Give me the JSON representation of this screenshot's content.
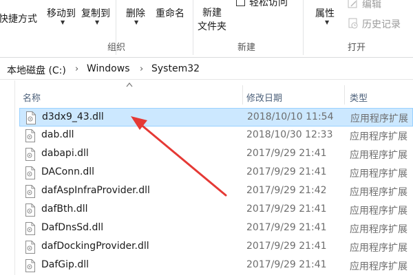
{
  "ribbon": {
    "clipboard": {
      "paste_shortcut_label": "快捷方式",
      "move_to_label": "移动到",
      "copy_to_label": "复制到"
    },
    "organize": {
      "delete_label": "删除",
      "rename_label": "重命名",
      "group_label": "组织"
    },
    "new": {
      "new_folder_line1": "新建",
      "new_folder_line2": "文件夹",
      "easy_access_label": "轻松访问",
      "group_label": "新建"
    },
    "open": {
      "properties_label": "属性",
      "edit_label": "编辑",
      "history_label": "历史记录",
      "group_label": "打开"
    }
  },
  "address": {
    "crumbs": [
      "本地磁盘 (C:)",
      "Windows",
      "System32"
    ]
  },
  "columns": {
    "name": "名称",
    "date": "修改日期",
    "type": "类型"
  },
  "files": [
    {
      "name": "d3dx9_43.dll",
      "date": "2018/10/10 11:54",
      "type": "应用程序扩展",
      "selected": true
    },
    {
      "name": "dab.dll",
      "date": "2018/10/30 12:33",
      "type": "应用程序扩展",
      "selected": false
    },
    {
      "name": "dabapi.dll",
      "date": "2017/9/29 21:41",
      "type": "应用程序扩展",
      "selected": false
    },
    {
      "name": "DAConn.dll",
      "date": "2017/9/29 21:41",
      "type": "应用程序扩展",
      "selected": false
    },
    {
      "name": "dafAspInfraProvider.dll",
      "date": "2017/9/29 21:42",
      "type": "应用程序扩展",
      "selected": false
    },
    {
      "name": "dafBth.dll",
      "date": "2017/9/29 21:41",
      "type": "应用程序扩展",
      "selected": false
    },
    {
      "name": "DafDnsSd.dll",
      "date": "2017/9/29 21:41",
      "type": "应用程序扩展",
      "selected": false
    },
    {
      "name": "dafDockingProvider.dll",
      "date": "2017/9/29 21:41",
      "type": "应用程序扩展",
      "selected": false
    },
    {
      "name": "DafGip.dll",
      "date": "2017/9/29 21:41",
      "type": "应用程序扩展",
      "selected": false
    }
  ],
  "colors": {
    "selection_fill": "#cce8ff",
    "selection_border": "#99d1ff",
    "annotation_arrow": "#e53935",
    "header_text": "#4c607a"
  },
  "icons": [
    "dll-file-icon",
    "sort-caret-icon",
    "breadcrumb-chevron-icon",
    "properties-icon",
    "edit-icon",
    "history-icon",
    "annotation-arrow"
  ]
}
